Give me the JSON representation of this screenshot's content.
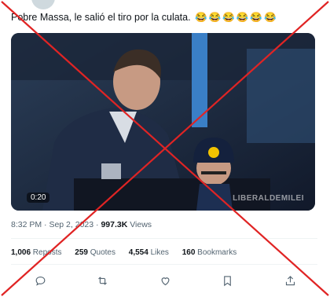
{
  "tweet": {
    "text": "Pobre Massa, le salió el tiro por la culata.",
    "emojis": [
      "😂",
      "😂",
      "😂",
      "😂",
      "😂",
      "😂"
    ]
  },
  "video": {
    "duration": "0:20",
    "watermark": "LIBERALDEMILEI"
  },
  "meta": {
    "time": "8:32 PM",
    "separator": " · ",
    "date": "Sep 2, 2023",
    "views_count": "997.3K",
    "views_label": " Views"
  },
  "stats": {
    "reposts_count": "1,006",
    "reposts_label": " Reposts",
    "quotes_count": "259",
    "quotes_label": " Quotes",
    "likes_count": "4,554",
    "likes_label": " Likes",
    "bookmarks_count": "160",
    "bookmarks_label": " Bookmarks"
  },
  "actions": [
    {
      "icon": "reply-icon"
    },
    {
      "icon": "repost-icon"
    },
    {
      "icon": "like-icon"
    },
    {
      "icon": "bookmark-icon"
    },
    {
      "icon": "share-icon"
    }
  ],
  "colors": {
    "cross": "#e02424",
    "text": "#0f1419",
    "muted": "#536471"
  }
}
